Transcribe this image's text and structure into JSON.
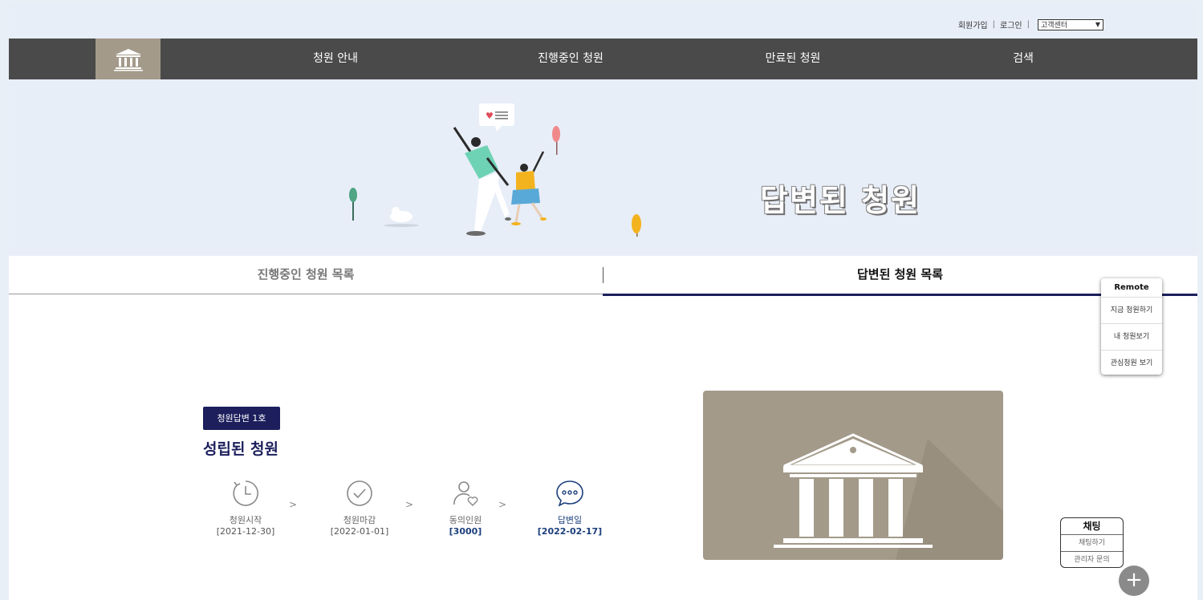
{
  "utility": {
    "signup": "회원가입",
    "login": "로그인",
    "customer_center": "고객센터"
  },
  "nav": {
    "items": [
      "청원 안내",
      "진행중인 청원",
      "만료된 청원",
      "검색"
    ]
  },
  "hero": {
    "title": "답변된 청원"
  },
  "tabs": {
    "in_progress": "진행중인 청원 목록",
    "answered": "답변된 청원 목록"
  },
  "petition": {
    "badge": "청원답변 1호",
    "title": "성립된 청원",
    "steps": [
      {
        "label": "청원시작",
        "value": "[2021-12-30]"
      },
      {
        "label": "청원마감",
        "value": "[2022-01-01]"
      },
      {
        "label": "동의인원",
        "value": "[3000]"
      },
      {
        "label": "답변일",
        "value": "[2022-02-17]"
      }
    ]
  },
  "remote": {
    "title": "Remote",
    "items": [
      "지금 청원하기",
      "내 청원보기",
      "관심청원 보기"
    ]
  },
  "chat": {
    "title": "채팅",
    "items": [
      "채팅하기",
      "관리자 문의"
    ],
    "plus": "+"
  },
  "colors": {
    "navy": "#1c1f5c",
    "nav_bg": "#4a4a4a",
    "logo_bg": "#a39a8a",
    "hero_bg": "#e8eef8"
  }
}
